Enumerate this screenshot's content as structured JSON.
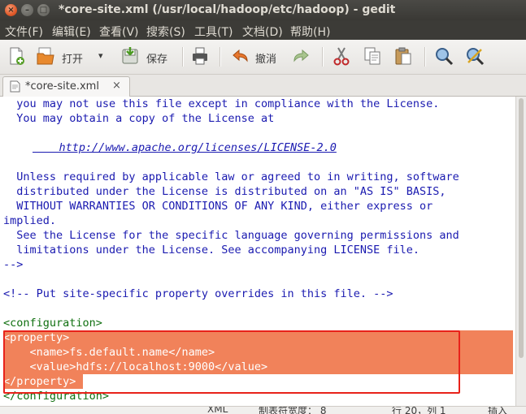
{
  "window": {
    "title": "*core-site.xml (/usr/local/hadoop/etc/hadoop) - gedit",
    "close_glyph": "×",
    "min_glyph": "–",
    "max_glyph": "□"
  },
  "menu": {
    "items": [
      "文件(F)",
      "编辑(E)",
      "查看(V)",
      "搜索(S)",
      "工具(T)",
      "文档(D)",
      "帮助(H)"
    ]
  },
  "toolbar": {
    "open_label": "打开",
    "save_label": "保存",
    "undo_label": "撤消",
    "dropdown_glyph": "▾",
    "icons": [
      "new-document-icon",
      "open-folder-icon",
      "save-icon",
      "print-icon",
      "undo-icon",
      "redo-icon",
      "cut-icon",
      "copy-icon",
      "paste-icon",
      "search-icon",
      "replace-icon"
    ]
  },
  "tab": {
    "label": "*core-site.xml",
    "close_glyph": "×"
  },
  "editor": {
    "lines": [
      "  you may not use this file except in compliance with the License.",
      "  You may obtain a copy of the License at",
      "",
      "    http://www.apache.org/licenses/LICENSE-2.0",
      "",
      "  Unless required by applicable law or agreed to in writing, software",
      "  distributed under the License is distributed on an \"AS IS\" BASIS,",
      "  WITHOUT WARRANTIES OR CONDITIONS OF ANY KIND, either express or",
      "implied.",
      "  See the License for the specific language governing permissions and",
      "  limitations under the License. See accompanying LICENSE file.",
      "-->",
      "",
      "<!-- Put site-specific property overrides in this file. -->",
      "",
      "<configuration>",
      "<property>",
      "    <name>fs.default.name</name>",
      "    <value>hdfs://localhost:9000</value>",
      "</property>",
      "</configuration>"
    ]
  },
  "statusbar": {
    "language": "XML",
    "tab_width": "制表符宽度： 8",
    "position": "行 20，列 1",
    "mode": "插入"
  },
  "colors": {
    "selection": "#f1825a",
    "highlight_box": "#e8221a",
    "text_blue": "#1a1ab0",
    "tag_green": "#107010"
  }
}
